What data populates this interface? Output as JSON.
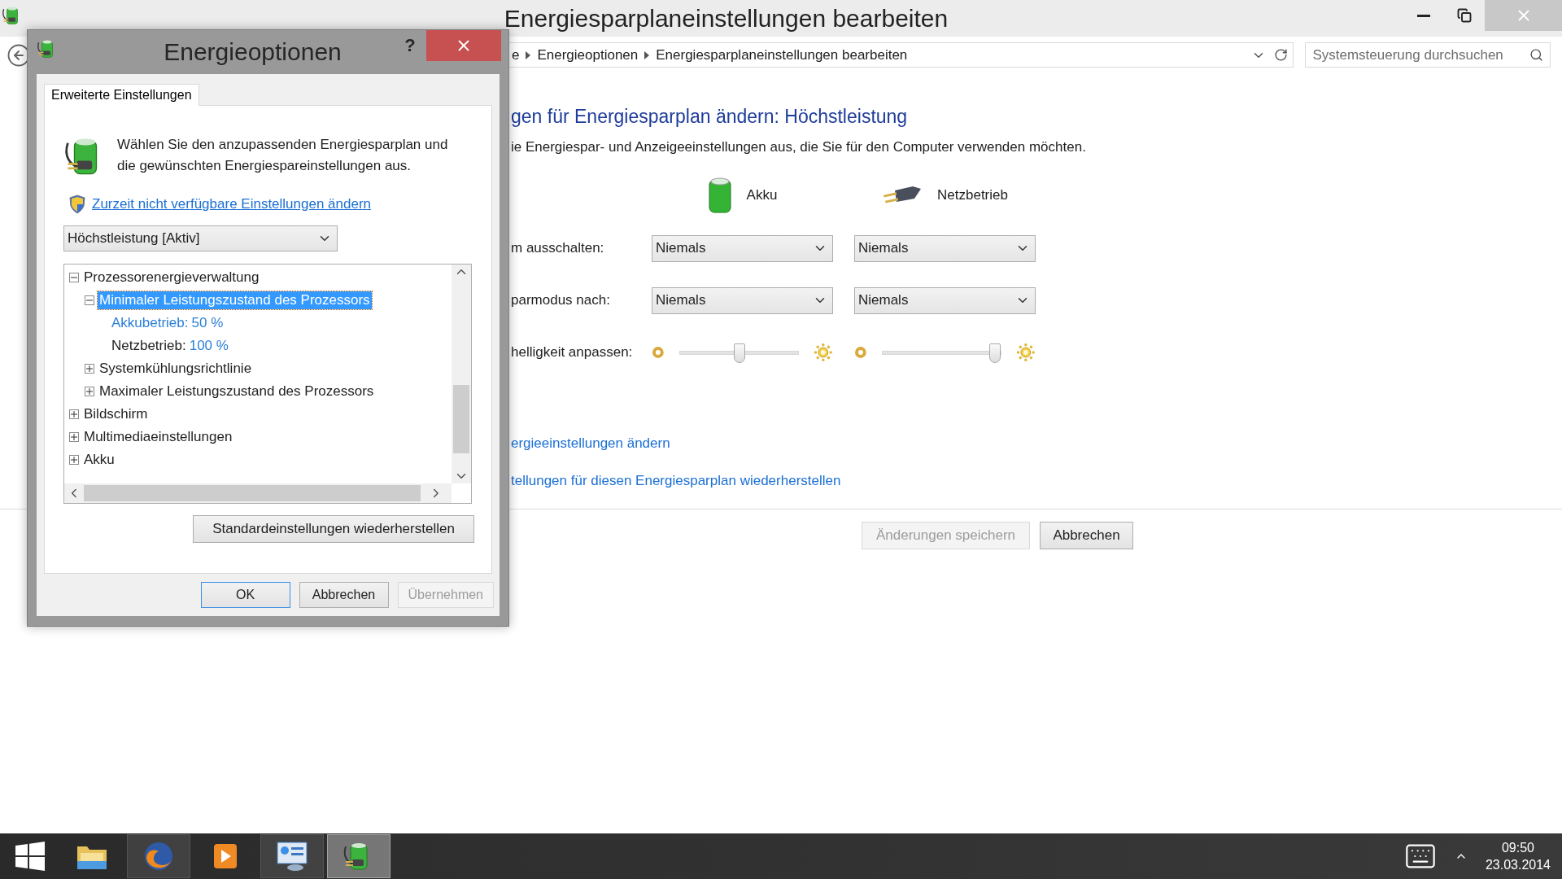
{
  "main_window": {
    "title": "Energiesparplaneinstellungen bearbeiten",
    "breadcrumb": [
      "e",
      "Energieoptionen",
      "Energiesparplaneinstellungen bearbeiten"
    ],
    "search": {
      "placeholder": "Systemsteuerung durchsuchen"
    },
    "heading": "gen für Energiesparplan ändern: Höchstleistung",
    "description": "ie Energiespar- und Anzeigeeinstellungen aus, die Sie für den Computer verwenden möchten.",
    "columns": [
      "Akku",
      "Netzbetrieb"
    ],
    "settings": [
      {
        "kind": "dropdown",
        "label": "m ausschalten:",
        "values": [
          "Niemals",
          "Niemals"
        ]
      },
      {
        "kind": "dropdown",
        "label": "parmodus nach:",
        "values": [
          "Niemals",
          "Niemals"
        ]
      },
      {
        "kind": "slider",
        "label": "helligkeit anpassen:",
        "sliders": [
          {
            "level": 0.5
          },
          {
            "level": 0.95
          }
        ]
      }
    ],
    "links": [
      "ergieeinstellungen ändern",
      "tellungen für diesen Energiesparplan wiederherstellen"
    ],
    "buttons": [
      {
        "label": "Änderungen speichern",
        "disabled": true
      },
      {
        "label": "Abbrechen",
        "disabled": false
      }
    ]
  },
  "dialog": {
    "title": "Energieoptionen",
    "help": "?",
    "tabs": [
      {
        "label": "Erweiterte Einstellungen",
        "selected": true
      }
    ],
    "intro": "Wählen Sie den anzupassenden Energiesparplan und die gewünschten Energiespareinstellungen aus.",
    "link": "Zurzeit nicht verfügbare Einstellungen ändern",
    "plan": "Höchstleistung [Aktiv]",
    "tree": [
      {
        "kind": "node",
        "label": "Prozessorenergieverwaltung",
        "expanded": true,
        "selected": false,
        "children": [
          {
            "kind": "node",
            "label": "Minimaler Leistungszustand des Prozessors",
            "expanded": true,
            "selected": true,
            "children": [
              {
                "kind": "value",
                "label": "Akkubetrieb:",
                "value": "50 %",
                "highlighted": true
              },
              {
                "kind": "value",
                "label": "Netzbetrieb:",
                "value": "100 %",
                "highlighted": false
              }
            ]
          },
          {
            "kind": "node",
            "label": "Systemkühlungsrichtlinie",
            "expanded": false,
            "selected": false
          },
          {
            "kind": "node",
            "label": "Maximaler Leistungszustand des Prozessors",
            "expanded": false,
            "selected": false
          }
        ]
      },
      {
        "kind": "node",
        "label": "Bildschirm",
        "expanded": false,
        "selected": false
      },
      {
        "kind": "node",
        "label": "Multimediaeinstellungen",
        "expanded": false,
        "selected": false
      },
      {
        "kind": "node",
        "label": "Akku",
        "expanded": false,
        "selected": false
      }
    ],
    "reset_button": "Standardeinstellungen wiederherstellen",
    "buttons": [
      {
        "label": "OK",
        "default": true,
        "disabled": false
      },
      {
        "label": "Abbrechen",
        "default": false,
        "disabled": false
      },
      {
        "label": "Übernehmen",
        "default": false,
        "disabled": true
      }
    ]
  },
  "taskbar": {
    "apps": [
      {
        "kind": "folder",
        "running": false,
        "selected": false
      },
      {
        "kind": "browser",
        "running": true,
        "selected": false
      },
      {
        "kind": "player",
        "running": false,
        "selected": false
      },
      {
        "kind": "panel",
        "running": true,
        "selected": false
      },
      {
        "kind": "power",
        "running": true,
        "selected": true
      }
    ],
    "time": "09:50",
    "date": "23.03.2014"
  }
}
